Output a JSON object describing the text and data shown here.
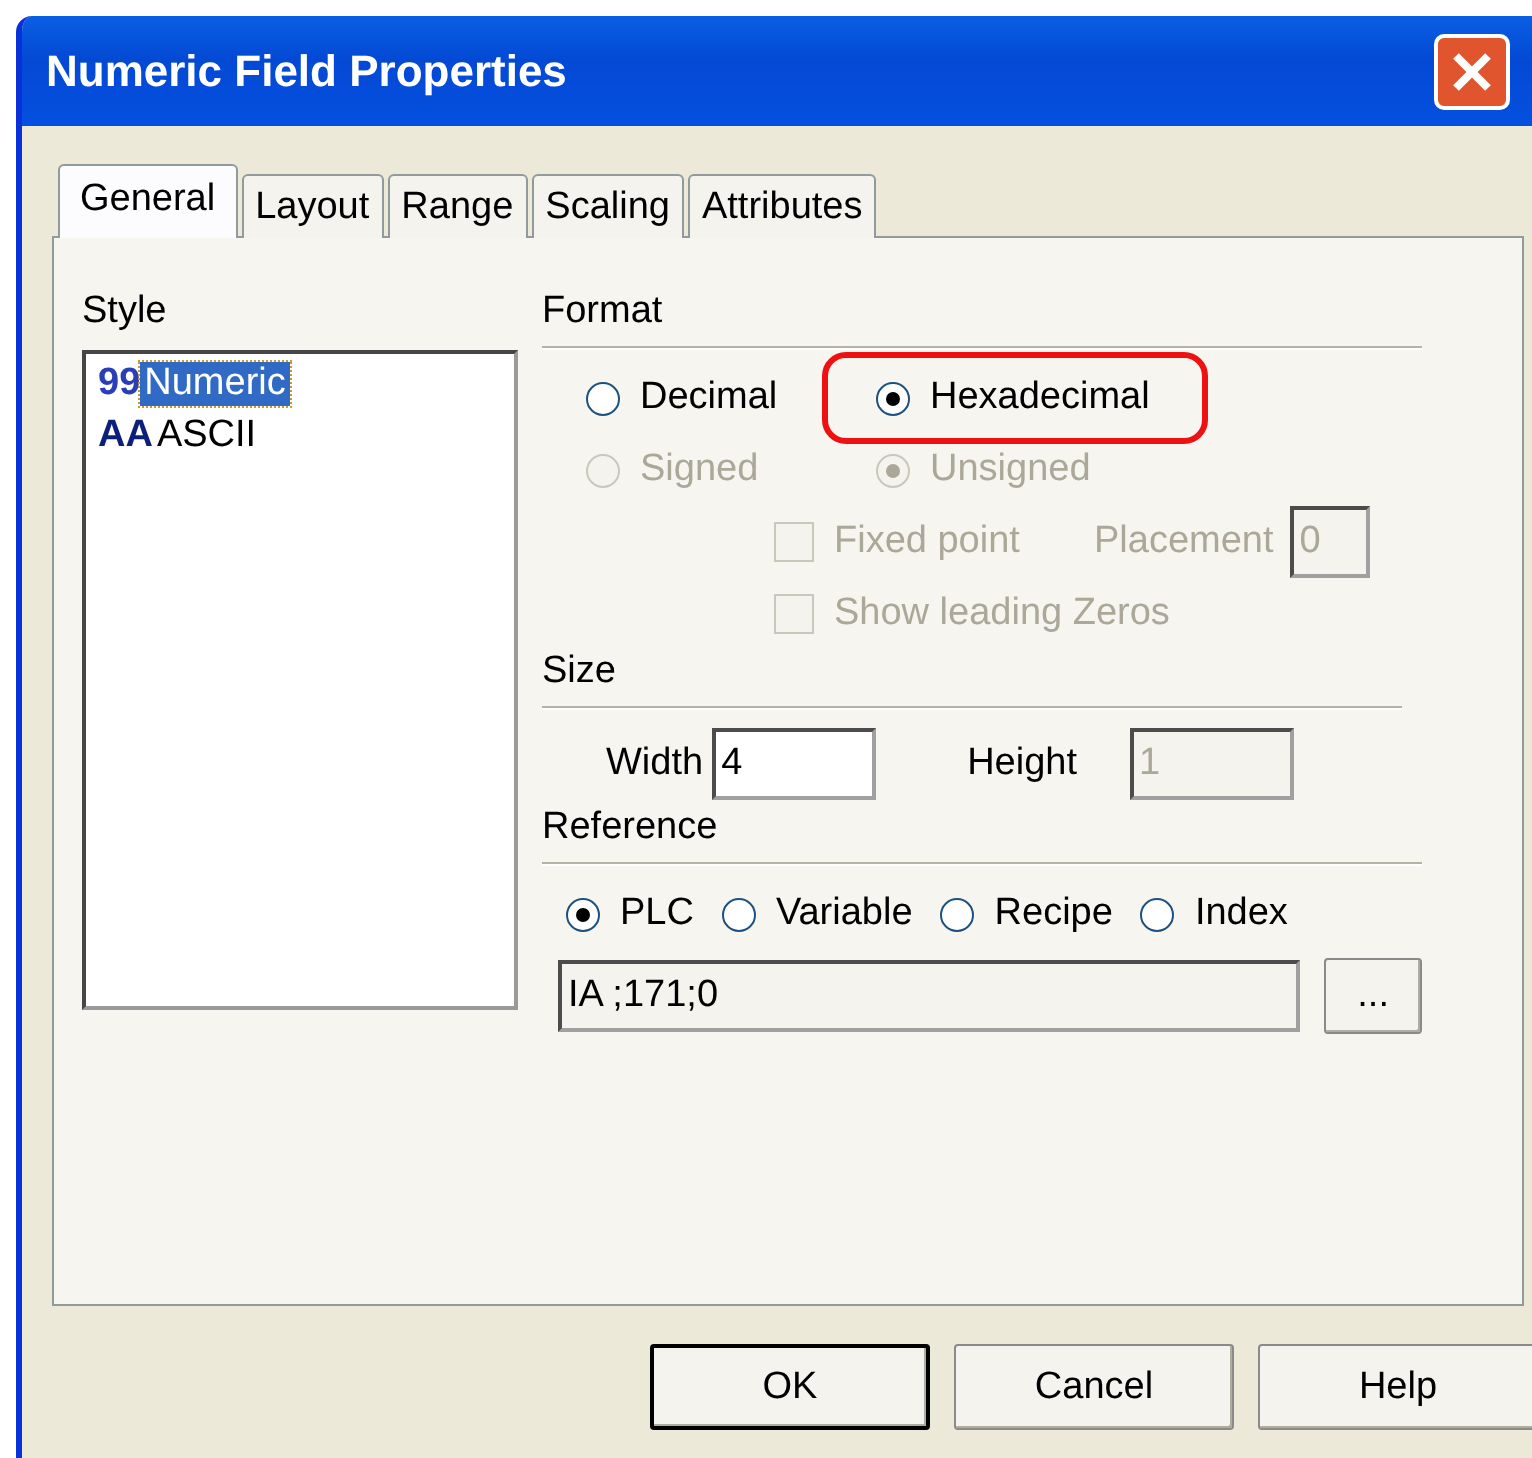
{
  "window": {
    "title": "Numeric Field Properties"
  },
  "tabs": [
    {
      "label": "General",
      "selected": true
    },
    {
      "label": "Layout",
      "selected": false
    },
    {
      "label": "Range",
      "selected": false
    },
    {
      "label": "Scaling",
      "selected": false
    },
    {
      "label": "Attributes",
      "selected": false
    }
  ],
  "style": {
    "label": "Style",
    "items": [
      {
        "glyph": "99",
        "label": "Numeric",
        "selected": true
      },
      {
        "glyph": "AA",
        "label": "ASCII",
        "selected": false
      }
    ]
  },
  "format": {
    "label": "Format",
    "options": [
      {
        "label": "Decimal",
        "selected": false,
        "disabled": false,
        "highlighted": false
      },
      {
        "label": "Hexadecimal",
        "selected": true,
        "disabled": false,
        "highlighted": true
      }
    ],
    "sign_options": [
      {
        "label": "Signed",
        "selected": false,
        "disabled": true
      },
      {
        "label": "Unsigned",
        "selected": true,
        "disabled": true
      }
    ],
    "checkboxes": [
      {
        "label": "Fixed point",
        "checked": false,
        "disabled": true
      },
      {
        "label": "Show leading Zeros",
        "checked": false,
        "disabled": true
      }
    ],
    "placement": {
      "label": "Placement",
      "value": "0",
      "disabled": true
    }
  },
  "size": {
    "label": "Size",
    "width": {
      "label": "Width",
      "value": "4",
      "disabled": false
    },
    "height": {
      "label": "Height",
      "value": "1",
      "disabled": true
    }
  },
  "reference": {
    "label": "Reference",
    "options": [
      {
        "label": "PLC",
        "selected": true
      },
      {
        "label": "Variable",
        "selected": false
      },
      {
        "label": "Recipe",
        "selected": false
      },
      {
        "label": "Index",
        "selected": false
      }
    ],
    "address": {
      "value": "IA ;171;0"
    },
    "browse_button": "..."
  },
  "buttons": [
    {
      "label": "OK",
      "default": true
    },
    {
      "label": "Cancel",
      "default": false
    },
    {
      "label": "Help",
      "default": false
    }
  ]
}
